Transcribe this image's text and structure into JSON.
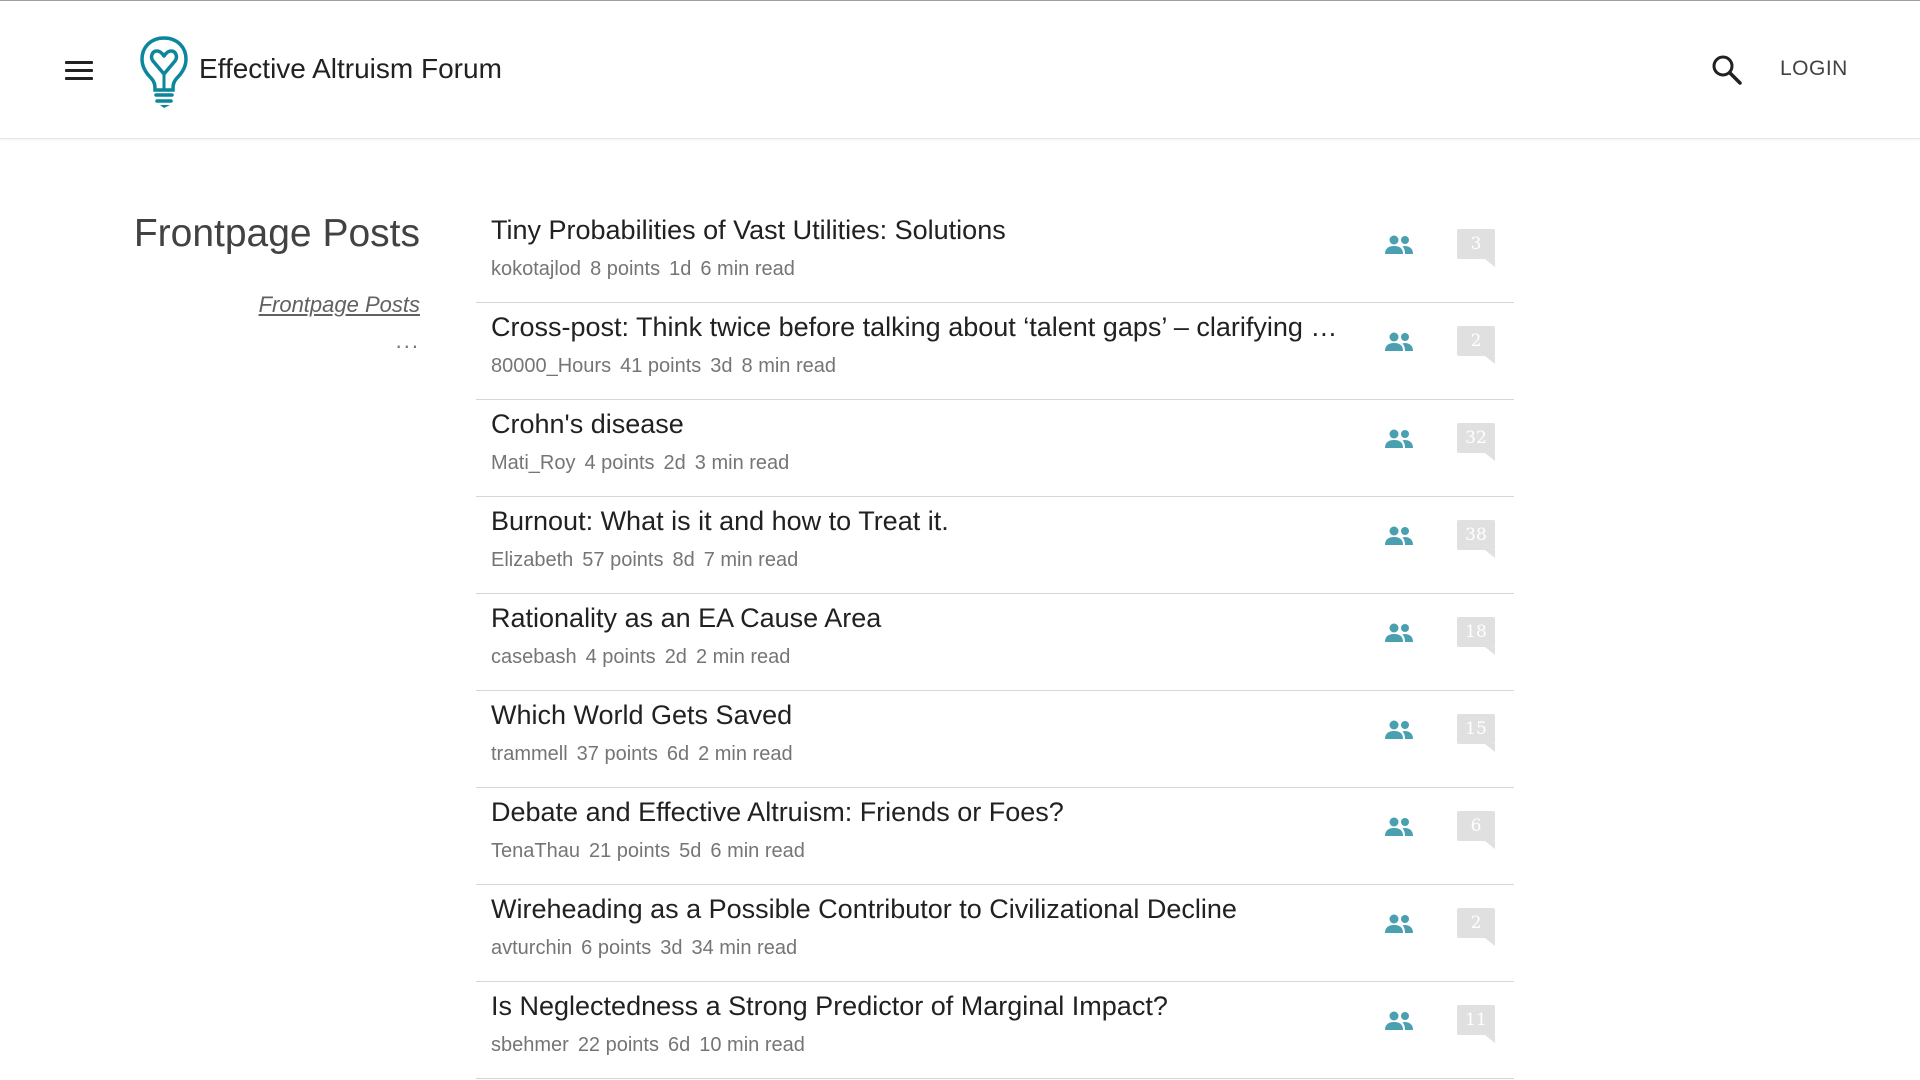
{
  "header": {
    "site_title": "Effective Altruism Forum",
    "login_label": "LOGIN",
    "brand_color": "#0c869b"
  },
  "sidebar": {
    "title": "Frontpage Posts",
    "link_label": "Frontpage Posts",
    "more_label": "..."
  },
  "posts": [
    {
      "title": "Tiny Probabilities of Vast Utilities: Solutions",
      "author": "kokotajlod",
      "points": "8 points",
      "age": "1d",
      "read_time": "6 min read",
      "comments": "3"
    },
    {
      "title": "Cross-post: Think twice before talking about ‘talent gaps’ – clarifying nine misconceptions",
      "author": "80000_Hours",
      "points": "41 points",
      "age": "3d",
      "read_time": "8 min read",
      "comments": "2"
    },
    {
      "title": "Crohn's disease",
      "author": "Mati_Roy",
      "points": "4 points",
      "age": "2d",
      "read_time": "3 min read",
      "comments": "32"
    },
    {
      "title": "Burnout: What is it and how to Treat it.",
      "author": "Elizabeth",
      "points": "57 points",
      "age": "8d",
      "read_time": "7 min read",
      "comments": "38"
    },
    {
      "title": "Rationality as an EA Cause Area",
      "author": "casebash",
      "points": "4 points",
      "age": "2d",
      "read_time": "2 min read",
      "comments": "18"
    },
    {
      "title": "Which World Gets Saved",
      "author": "trammell",
      "points": "37 points",
      "age": "6d",
      "read_time": "2 min read",
      "comments": "15"
    },
    {
      "title": "Debate and Effective Altruism: Friends or Foes?",
      "author": "TenaThau",
      "points": "21 points",
      "age": "5d",
      "read_time": "6 min read",
      "comments": "6"
    },
    {
      "title": "Wireheading as a Possible Contributor to Civilizational Decline",
      "author": "avturchin",
      "points": "6 points",
      "age": "3d",
      "read_time": "34 min read",
      "comments": "2"
    },
    {
      "title": "Is Neglectedness a Strong Predictor of Marginal Impact?",
      "author": "sbehmer",
      "points": "22 points",
      "age": "6d",
      "read_time": "10 min read",
      "comments": "11"
    }
  ],
  "icons": {
    "menu": "hamburger-menu-icon",
    "logo": "lightbulb-heart-logo",
    "search": "search-icon",
    "people": "people-icon",
    "comments": "comment-bubble-icon"
  },
  "colors": {
    "people_icon": "#4a9fb0",
    "comment_bubble": "#e0e0e0"
  }
}
